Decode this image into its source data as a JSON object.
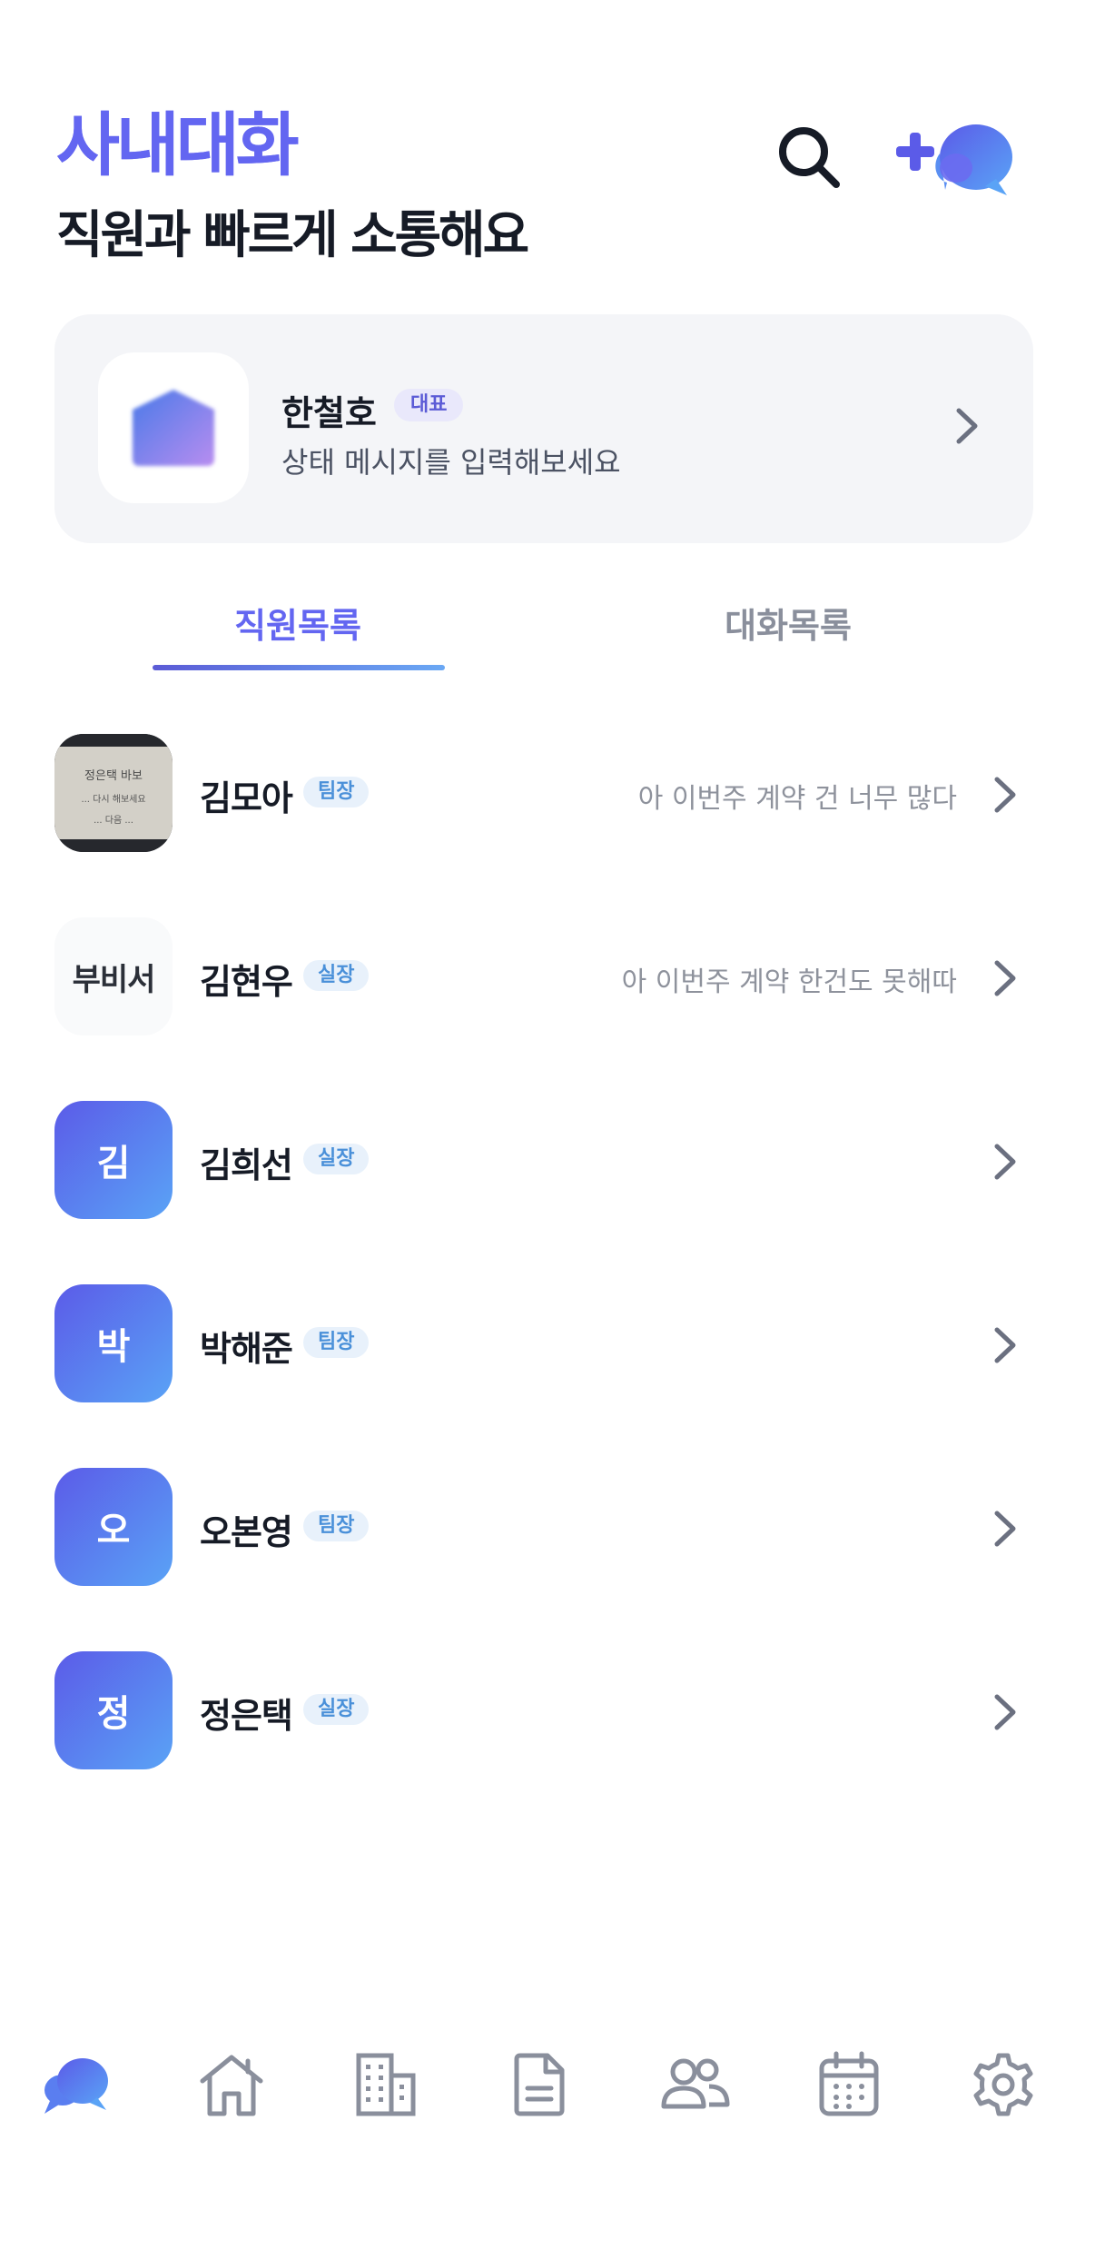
{
  "header": {
    "title": "사내대화",
    "subtitle": "직원과 빠르게 소통해요"
  },
  "profile": {
    "name": "한철호",
    "rank": "대표",
    "status_placeholder": "상태 메시지를 입력해보세요"
  },
  "tabs": [
    {
      "label": "직원목록",
      "active": true
    },
    {
      "label": "대화목록",
      "active": false
    }
  ],
  "staff": [
    {
      "avatar": "photo",
      "photo_caption": [
        "정은택 바보",
        "... 다시 해보세요",
        "... 다음 ..."
      ],
      "name": "김모아",
      "rank": "팀장",
      "last_message": "아 이번주 계약 건 너무 많다"
    },
    {
      "avatar_text": "부비서",
      "name": "김현우",
      "rank": "실장",
      "last_message": "아 이번주 계약 한건도 못해따"
    },
    {
      "avatar_text": "김",
      "name": "김희선",
      "rank": "실장",
      "last_message": ""
    },
    {
      "avatar_text": "박",
      "name": "박해준",
      "rank": "팀장",
      "last_message": ""
    },
    {
      "avatar_text": "오",
      "name": "오본영",
      "rank": "팀장",
      "last_message": ""
    },
    {
      "avatar_text": "정",
      "name": "정은택",
      "rank": "실장",
      "last_message": ""
    }
  ],
  "nav": [
    {
      "icon": "chat-bubbles-icon",
      "active": true
    },
    {
      "icon": "home-icon",
      "active": false
    },
    {
      "icon": "building-icon",
      "active": false
    },
    {
      "icon": "document-icon",
      "active": false
    },
    {
      "icon": "users-icon",
      "active": false
    },
    {
      "icon": "calendar-icon",
      "active": false
    },
    {
      "icon": "gear-icon",
      "active": false
    }
  ],
  "colors": {
    "accent": "#6366f1",
    "accent_gradient_end": "#5aa3f6",
    "icon_inactive": "#8a8f9c",
    "card_bg": "#f4f5f8"
  }
}
